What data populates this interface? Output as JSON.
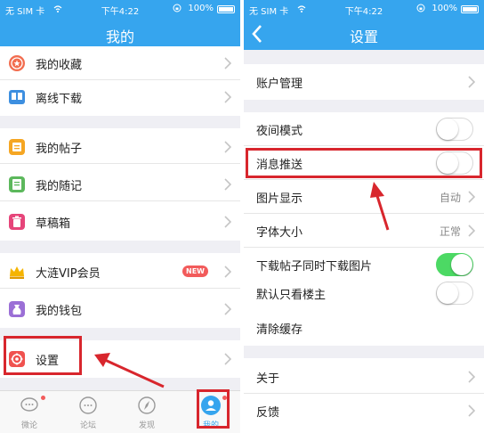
{
  "status": {
    "carrier": "无 SIM 卡",
    "time": "下午4:22",
    "battery": "100%"
  },
  "left": {
    "title": "我的",
    "items": [
      {
        "label": "我的收藏"
      },
      {
        "label": "离线下载"
      },
      {
        "label": "我的帖子"
      },
      {
        "label": "我的随记"
      },
      {
        "label": "草稿箱"
      },
      {
        "label": "大涟VIP会员",
        "badge": "NEW"
      },
      {
        "label": "我的钱包"
      },
      {
        "label": "设置"
      }
    ],
    "tabs": [
      {
        "label": "微论"
      },
      {
        "label": "论坛"
      },
      {
        "label": "发现"
      },
      {
        "label": "我的"
      }
    ]
  },
  "right": {
    "title": "设置",
    "items": [
      {
        "label": "账户管理"
      },
      {
        "label": "夜间模式",
        "toggle": false
      },
      {
        "label": "消息推送",
        "toggle": false
      },
      {
        "label": "图片显示",
        "value": "自动"
      },
      {
        "label": "字体大小",
        "value": "正常"
      },
      {
        "label": "下载帖子同时下载图片",
        "toggle": true
      },
      {
        "label": "默认只看楼主",
        "toggle": false
      },
      {
        "label": "清除缓存"
      },
      {
        "label": "关于"
      },
      {
        "label": "反馈"
      }
    ]
  },
  "colors": {
    "accent": "#36a5ee",
    "highlight": "#d8262d",
    "toggle_on": "#4cd964",
    "badge": "#f25b5b"
  }
}
